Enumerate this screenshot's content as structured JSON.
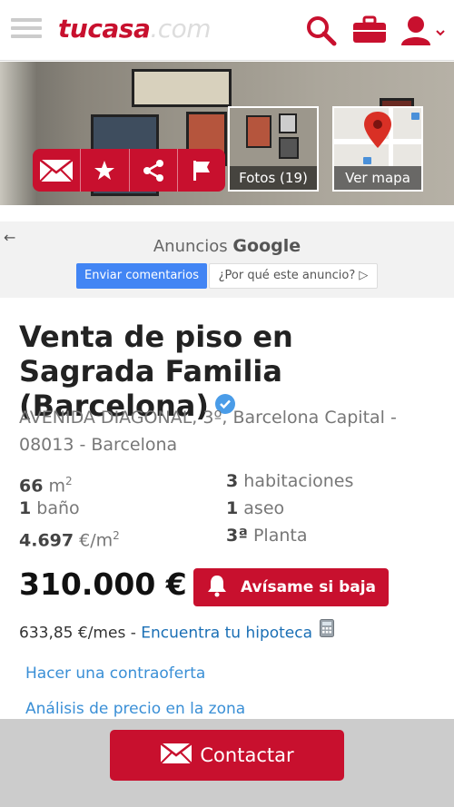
{
  "header": {
    "logo_brand": "tucasa",
    "logo_tld": ".com",
    "icons": [
      "menu-icon",
      "search-icon",
      "briefcase-icon",
      "user-icon"
    ]
  },
  "hero": {
    "actions": [
      "mail-icon",
      "star-icon",
      "share-icon",
      "flag-icon"
    ],
    "photos_label": "Fotos (19)",
    "map_label": "Ver mapa"
  },
  "ads": {
    "title_prefix": "Anuncios",
    "title_brand": "Google",
    "feedback_button": "Enviar comentarios",
    "why_button": "¿Por qué este anuncio? ▷"
  },
  "listing": {
    "title": "Venta de piso en Sagrada Familia (Barcelona)",
    "address_line1": "AVENIDA DIAGONAL, 3º, Barcelona Capital -",
    "address_line2": "08013 - Barcelona",
    "stats": {
      "area_value": "66",
      "area_unit": " m",
      "area_sup": "2",
      "bedrooms_value": "3",
      "bedrooms_label": " habitaciones",
      "bathrooms_value": "1",
      "bathrooms_label": " baño",
      "toilets_value": "1",
      "toilets_label": " aseo",
      "price_m2_value": "4.697",
      "price_m2_unit": " €/m",
      "price_m2_sup": "2",
      "floor_value": "3ª",
      "floor_label": " Planta"
    },
    "price": "310.000 €",
    "alert_button": "Avísame si baja",
    "monthly_text": "633,85 €/mes - ",
    "mortgage_link": "Encuentra tu hipoteca",
    "counteroffer_link": "Hacer una contraoferta",
    "price_analysis_link": "Análisis de precio en la zona"
  },
  "footer": {
    "contact_button": "Contactar"
  },
  "colors": {
    "brand_red": "#c8102e",
    "link_blue": "#3a8fd6",
    "google_blue": "#4285f4"
  }
}
